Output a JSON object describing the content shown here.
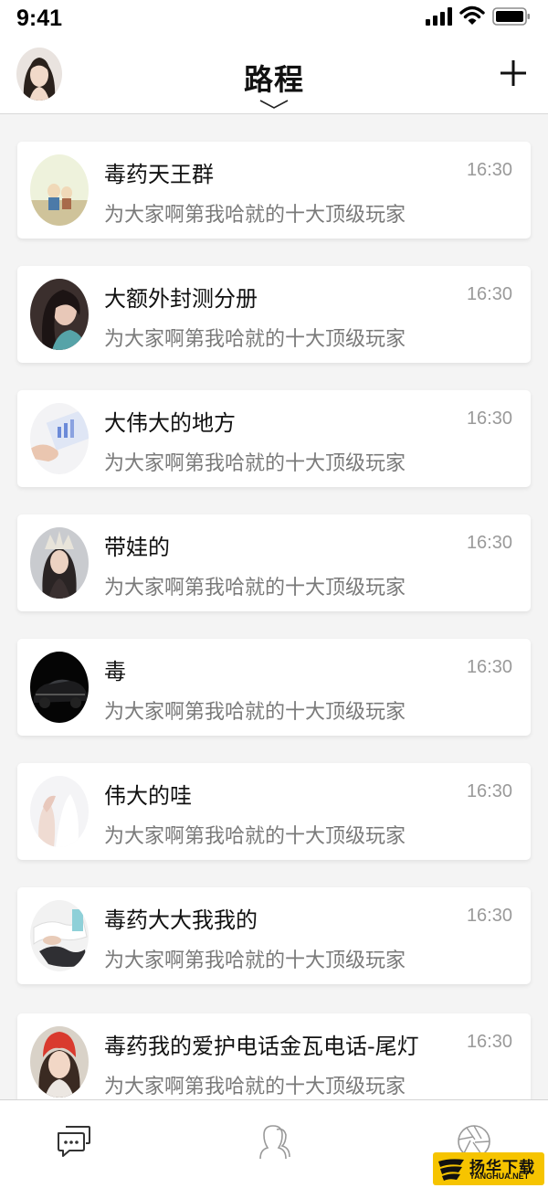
{
  "status_bar": {
    "time": "9:41",
    "icons": [
      "cellular-signal-icon",
      "wifi-icon",
      "battery-icon"
    ]
  },
  "header": {
    "title": "路程",
    "left_icon": "user-avatar",
    "right_icon": "plus-icon",
    "title_indicator_icon": "chevron-down-icon"
  },
  "conversations": [
    {
      "name": "毒药天王群",
      "message": "为大家啊第我哈就的十大顶级玩家",
      "time": "16:30"
    },
    {
      "name": "大额外封测分册",
      "message": "为大家啊第我哈就的十大顶级玩家",
      "time": "16:30"
    },
    {
      "name": "大伟大的地方",
      "message": "为大家啊第我哈就的十大顶级玩家",
      "time": "16:30"
    },
    {
      "name": "带娃的",
      "message": "为大家啊第我哈就的十大顶级玩家",
      "time": "16:30"
    },
    {
      "name": "毒",
      "message": "为大家啊第我哈就的十大顶级玩家",
      "time": "16:30"
    },
    {
      "name": "伟大的哇",
      "message": "为大家啊第我哈就的十大顶级玩家",
      "time": "16:30"
    },
    {
      "name": "毒药大大我我的",
      "message": "为大家啊第我哈就的十大顶级玩家",
      "time": "16:30"
    },
    {
      "name": "毒药我的爱护电话金瓦电话-尾灯",
      "message": "为大家啊第我哈就的十大顶级玩家",
      "time": "16:30"
    }
  ],
  "tab_bar": {
    "tabs": [
      {
        "icon": "chat-bubbles-icon",
        "active": true
      },
      {
        "icon": "contacts-icon",
        "active": false
      },
      {
        "icon": "aperture-icon",
        "active": false
      }
    ]
  },
  "watermark": {
    "text_cn": "扬华下载",
    "text_en": "YANGHUA.NET"
  },
  "colors": {
    "background": "#f4f4f4",
    "card": "#ffffff",
    "name_text": "#111111",
    "message_text": "#7a7a7a",
    "time_text": "#9a9a9a",
    "watermark_bg": "#f6c400"
  }
}
